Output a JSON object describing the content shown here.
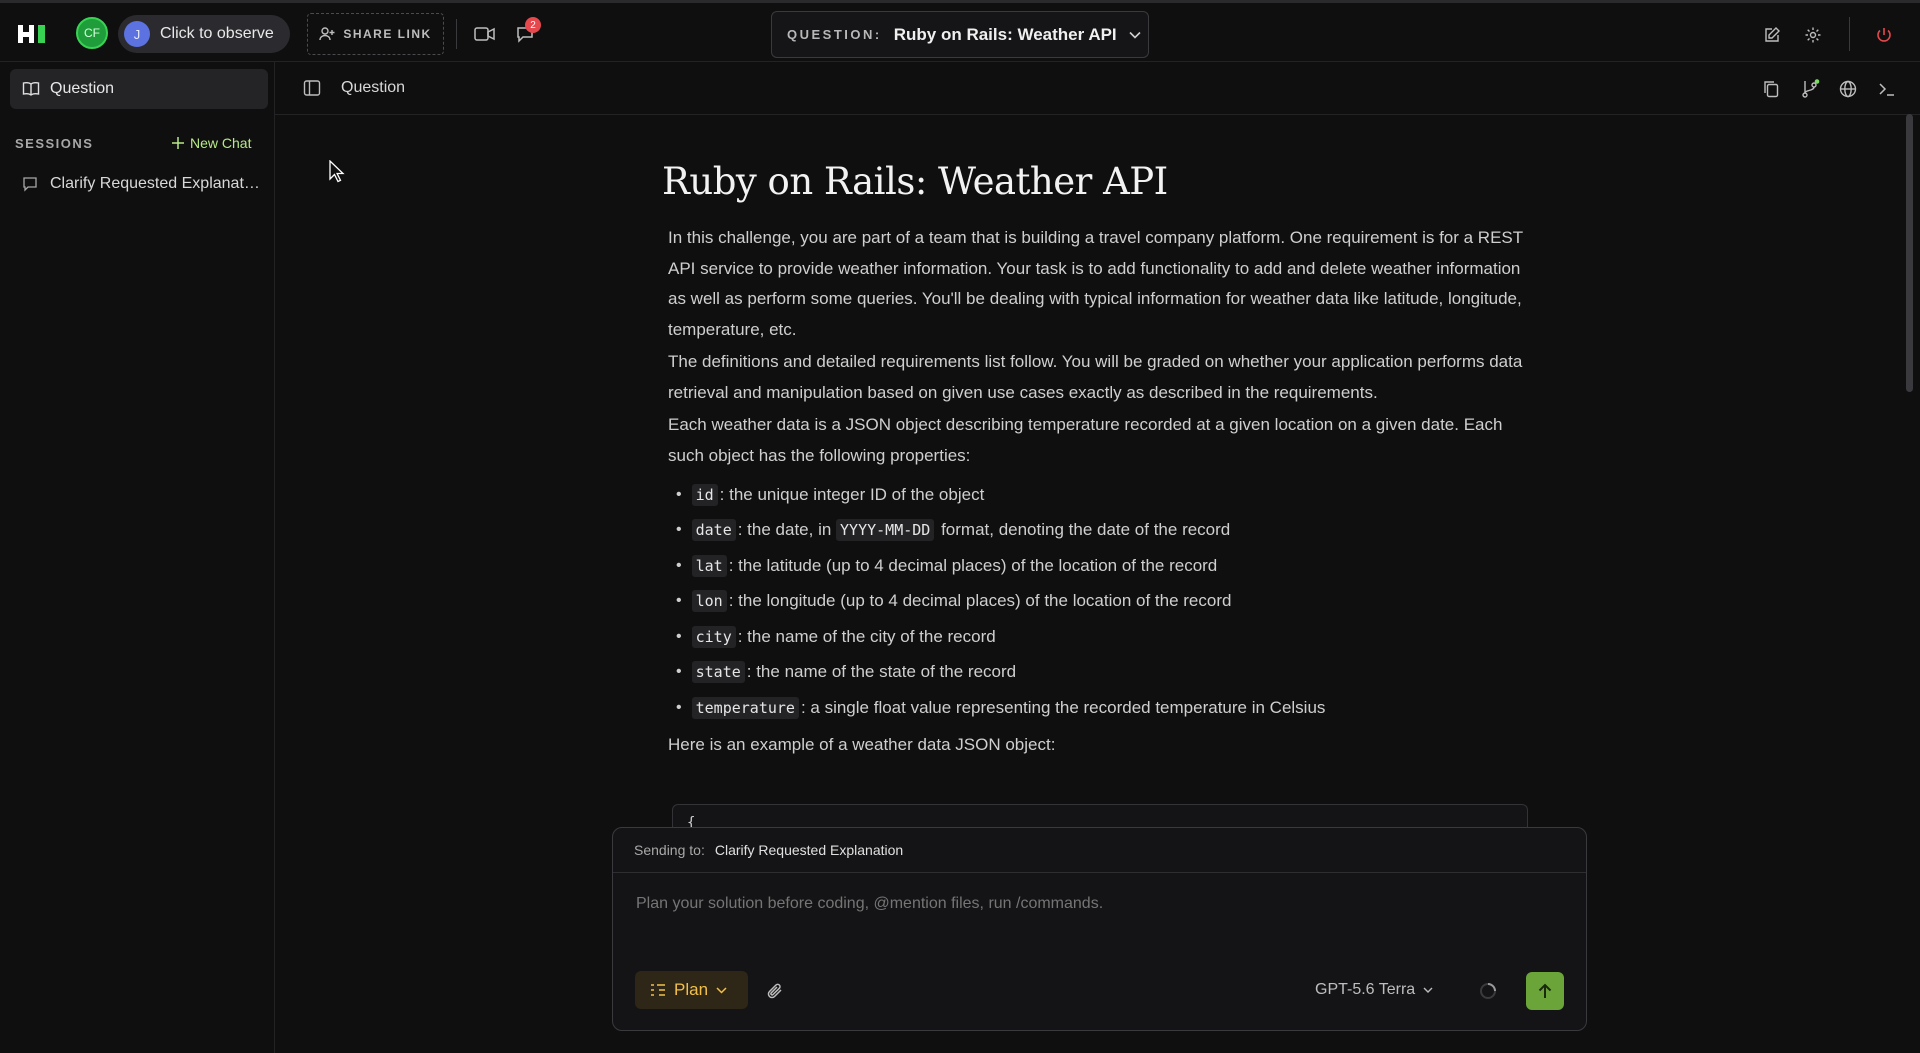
{
  "header": {
    "avatar_initials": "CF",
    "observer_initial": "J",
    "observe_label": "Click to observe",
    "share_label": "SHARE LINK",
    "notification_count": "2",
    "question_label": "QUESTION:",
    "question_value": "Ruby on Rails: Weather API"
  },
  "sidebar": {
    "question_label": "Question",
    "sessions_title": "SESSIONS",
    "new_chat_label": "New Chat",
    "sessions": [
      {
        "label": "Clarify Requested Explanati…"
      }
    ]
  },
  "subbar": {
    "title": "Question"
  },
  "document": {
    "title": "Ruby on Rails: Weather API",
    "para1": "In this challenge, you are part of a team that is building a travel company platform. One requirement is for a REST API service to provide weather information. Your task is to add functionality to add and delete weather information as well as perform some queries. You'll be dealing with typical information for weather data like latitude, longitude, temperature, etc.",
    "para2": "The definitions and detailed requirements list follow. You will be graded on whether your application performs data retrieval and manipulation based on given use cases exactly as described in the requirements.",
    "para3": "Each weather data is a JSON object describing temperature recorded at a given location on a given date. Each such object has the following properties:",
    "props": [
      {
        "code": "id",
        "text": ": the unique integer ID of the object"
      },
      {
        "code": "date",
        "text": ": the date, in ",
        "code2": "YYYY-MM-DD",
        "text2": " format, denoting the date of the record"
      },
      {
        "code": "lat",
        "text": ": the latitude (up to 4 decimal places) of the location of the record"
      },
      {
        "code": "lon",
        "text": ": the longitude (up to 4 decimal places) of the location of the record"
      },
      {
        "code": "city",
        "text": ": the name of the city of the record"
      },
      {
        "code": "state",
        "text": ": the name of the state of the record"
      },
      {
        "code": "temperature",
        "text": ": a single float value representing the recorded temperature in Celsius"
      }
    ],
    "para4": "Here is an example of a weather data JSON object:",
    "code_first_line": "{"
  },
  "composer": {
    "sending_to_label": "Sending to:",
    "sending_to_value": "Clarify Requested Explanation",
    "placeholder": "Plan your solution before coding, @mention files, run /commands.",
    "mode_label": "Plan",
    "model_label": "GPT-5.6 Terra"
  },
  "colors": {
    "background": "#0f0f10",
    "accent_green": "#6ba53a",
    "plan_yellow": "#f2c04a",
    "badge_red": "#e5484d",
    "power_red": "#e5484d"
  }
}
